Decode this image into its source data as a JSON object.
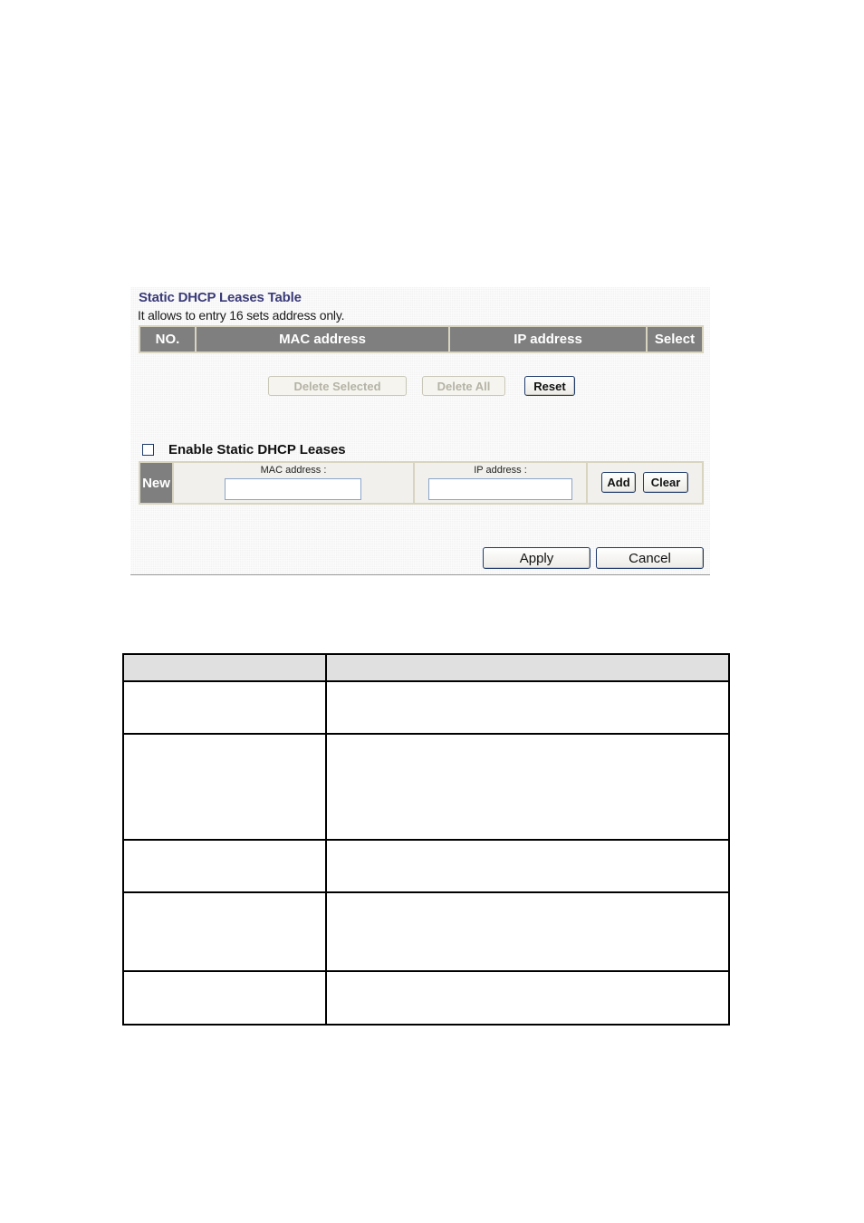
{
  "panel": {
    "title": "Static DHCP Leases Table",
    "subtitle": "It allows to entry 16 sets address only.",
    "columns": [
      "NO.",
      "MAC address",
      "IP address",
      "Select"
    ],
    "buttons": {
      "delete_selected": "Delete Selected",
      "delete_all": "Delete All",
      "reset": "Reset"
    },
    "enable_checkbox": {
      "label": "Enable Static DHCP Leases",
      "checked": false
    },
    "new_entry": {
      "row_label": "New",
      "mac_label": "MAC address :",
      "mac_value": "",
      "ip_label": "IP address :",
      "ip_value": "",
      "add": "Add",
      "clear": "Clear"
    },
    "footer": {
      "apply": "Apply",
      "cancel": "Cancel"
    },
    "colors": {
      "title": "#3b3b7a",
      "header_bg": "#7f7f7f",
      "button_border": "#1f3b6b"
    }
  },
  "description_table": {
    "header": [
      "",
      ""
    ],
    "rows": [
      [
        "",
        ""
      ],
      [
        "",
        ""
      ],
      [
        "",
        ""
      ],
      [
        "",
        ""
      ],
      [
        "",
        ""
      ]
    ]
  }
}
